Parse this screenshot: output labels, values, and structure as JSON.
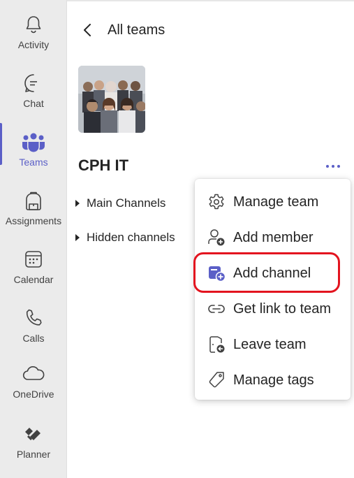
{
  "colors": {
    "accent": "#5b5fc7",
    "highlight": "#e3141f",
    "rail_bg": "#ebebeb"
  },
  "rail": {
    "items": [
      {
        "label": "Activity",
        "icon": "bell-icon"
      },
      {
        "label": "Chat",
        "icon": "chat-icon"
      },
      {
        "label": "Teams",
        "icon": "teams-icon",
        "active": true
      },
      {
        "label": "Assignments",
        "icon": "backpack-icon"
      },
      {
        "label": "Calendar",
        "icon": "calendar-icon"
      },
      {
        "label": "Calls",
        "icon": "phone-icon"
      },
      {
        "label": "OneDrive",
        "icon": "cloud-icon"
      },
      {
        "label": "Planner",
        "icon": "planner-icon"
      }
    ]
  },
  "header": {
    "back_label": "All teams"
  },
  "team": {
    "name": "CPH IT"
  },
  "channels": {
    "groups": [
      {
        "label": "Main Channels"
      },
      {
        "label": "Hidden channels"
      }
    ]
  },
  "menu": {
    "items": [
      {
        "label": "Manage team",
        "icon": "gear-icon"
      },
      {
        "label": "Add member",
        "icon": "person-add-icon"
      },
      {
        "label": "Add channel",
        "icon": "add-channel-icon",
        "highlighted": true
      },
      {
        "label": "Get link to team",
        "icon": "link-icon"
      },
      {
        "label": "Leave team",
        "icon": "leave-icon"
      },
      {
        "label": "Manage tags",
        "icon": "tag-icon"
      }
    ]
  }
}
